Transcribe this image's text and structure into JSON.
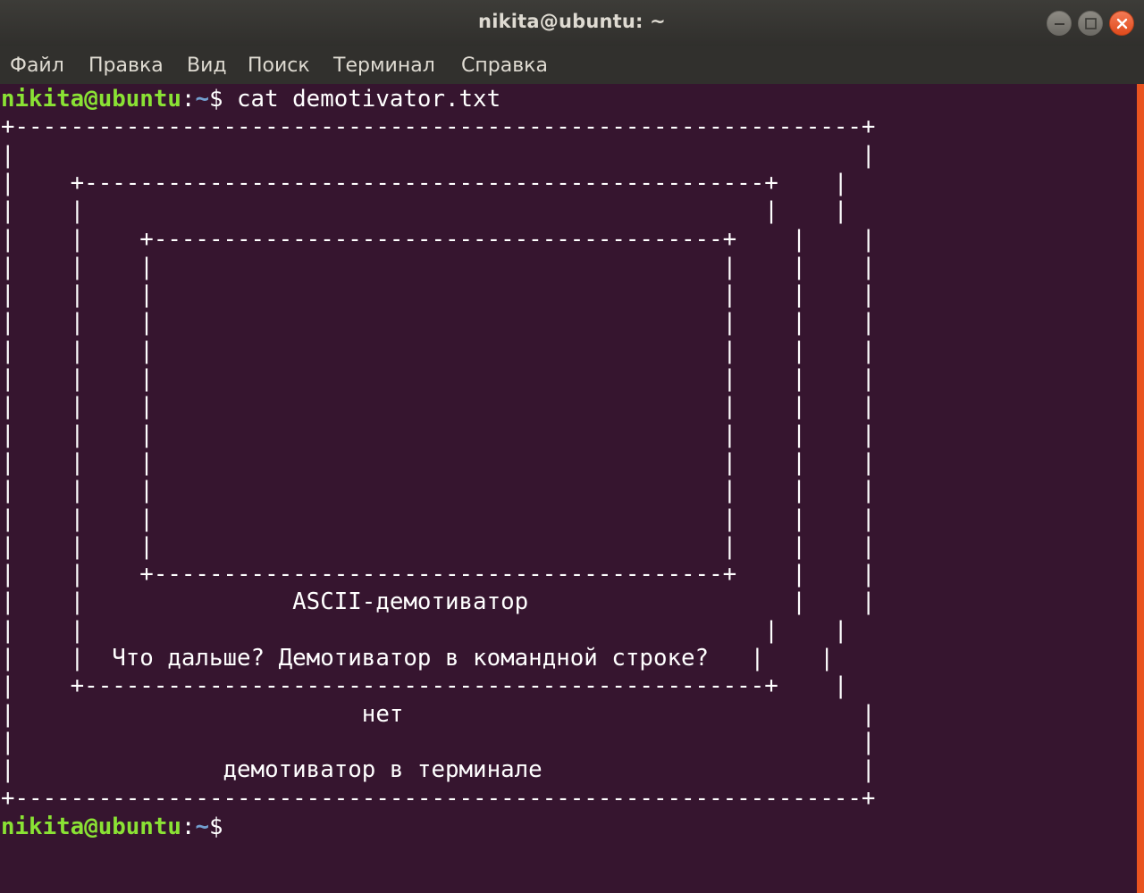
{
  "window": {
    "title": "nikita@ubuntu: ~",
    "controls": [
      "minimize-icon",
      "maximize-icon",
      "close-icon"
    ],
    "accent_color": "#e95420"
  },
  "menu": {
    "items": [
      "Файл",
      "Правка",
      "Вид",
      "Поиск",
      "Терминал",
      "Справка"
    ]
  },
  "terminal": {
    "background_color": "#36152f",
    "prompt_user": "nikita@ubuntu",
    "prompt_colon": ":",
    "prompt_path": "~",
    "prompt_dollar": "$",
    "command": " cat demotivator.txt",
    "output_lines": [
      "+-------------------------------------------------------------+",
      "|                                                             |",
      "|    +-------------------------------------------------+    |",
      "|    |                                                 |    |",
      "|    |    +-----------------------------------------+    |    |",
      "|    |    |                                         |    |    |",
      "|    |    |                                         |    |    |",
      "|    |    |                                         |    |    |",
      "|    |    |                                         |    |    |",
      "|    |    |                                         |    |    |",
      "|    |    |                                         |    |    |",
      "|    |    |                                         |    |    |",
      "|    |    |                                         |    |    |",
      "|    |    |                                         |    |    |",
      "|    |    |                                         |    |    |",
      "|    |    |                                         |    |    |",
      "|    |    +-----------------------------------------+    |    |",
      "|    |               ASCII-демотиватор                   |    |",
      "|    |                                                 |    |",
      "|    |  Что дальше? Демотиватор в командной строке?   |    |",
      "|    +-------------------------------------------------+    |",
      "|                         нет                                 |",
      "|                                                             |",
      "|               демотиватор в терминале                       |",
      "+-------------------------------------------------------------+"
    ]
  }
}
